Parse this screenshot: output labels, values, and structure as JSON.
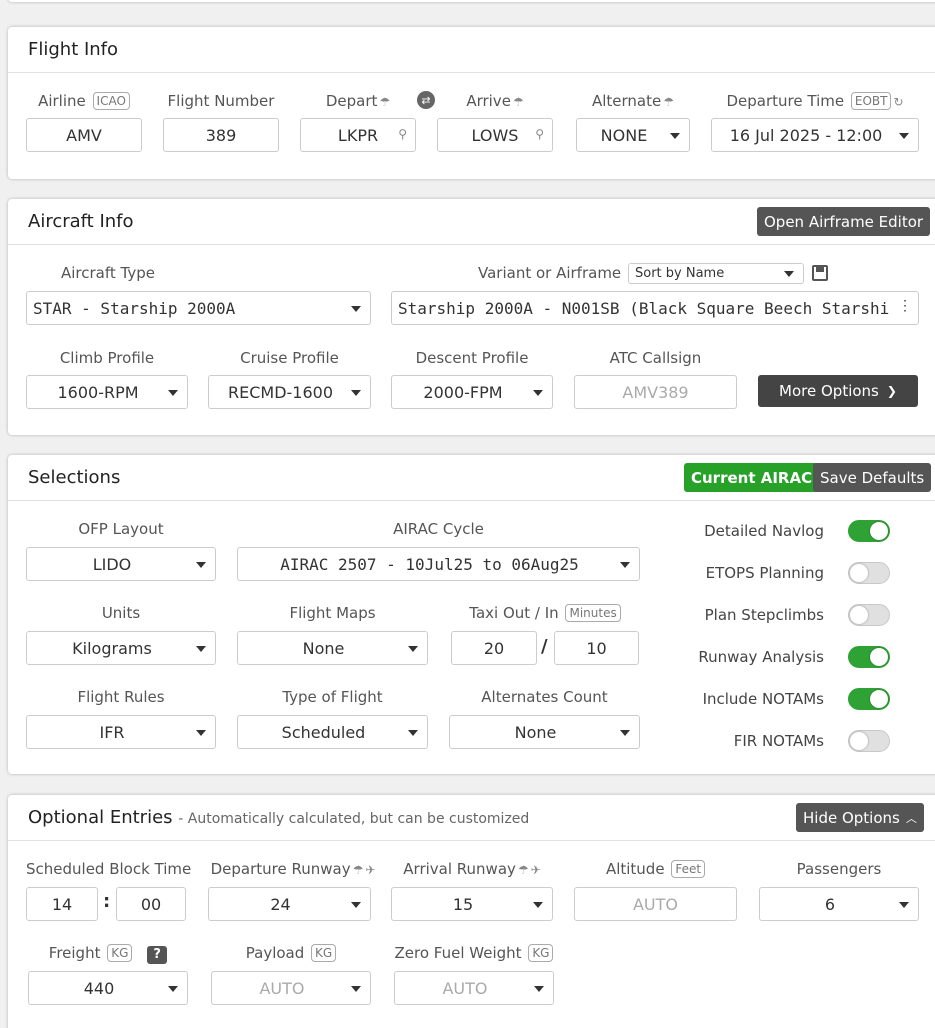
{
  "flight_info": {
    "title": "Flight Info",
    "airline": {
      "label": "Airline",
      "tag": "ICAO",
      "value": "AMV"
    },
    "flight_number": {
      "label": "Flight Number",
      "value": "389"
    },
    "depart": {
      "label": "Depart",
      "value": "LKPR"
    },
    "arrive": {
      "label": "Arrive",
      "value": "LOWS"
    },
    "alternate": {
      "label": "Alternate",
      "value": "NONE"
    },
    "departure_time": {
      "label": "Departure Time",
      "tag": "EOBT",
      "value": "16 Jul 2025 - 12:00"
    }
  },
  "aircraft_info": {
    "title": "Aircraft Info",
    "open_editor_label": "Open Airframe Editor",
    "aircraft_type": {
      "label": "Aircraft Type",
      "value": "STAR - Starship 2000A"
    },
    "variant": {
      "label": "Variant or Airframe",
      "sort_value": "Sort by Name",
      "value": "Starship 2000A - N001SB (Black Square Beech Starshi"
    },
    "climb_profile": {
      "label": "Climb Profile",
      "value": "1600-RPM"
    },
    "cruise_profile": {
      "label": "Cruise Profile",
      "value": "RECMD-1600"
    },
    "descent_profile": {
      "label": "Descent Profile",
      "value": "2000-FPM"
    },
    "atc_callsign": {
      "label": "ATC Callsign",
      "placeholder": "AMV389"
    },
    "more_options_label": "More Options"
  },
  "selections": {
    "title": "Selections",
    "current_airac_label": "Current AIRAC",
    "save_defaults_label": "Save Defaults",
    "ofp_layout": {
      "label": "OFP Layout",
      "value": "LIDO"
    },
    "airac_cycle": {
      "label": "AIRAC Cycle",
      "value": "AIRAC 2507 - 10Jul25 to 06Aug25"
    },
    "units": {
      "label": "Units",
      "value": "Kilograms"
    },
    "flight_maps": {
      "label": "Flight Maps",
      "value": "None"
    },
    "taxi": {
      "label": "Taxi Out / In",
      "tag": "Minutes",
      "out": "20",
      "sep": "/",
      "in": "10"
    },
    "flight_rules": {
      "label": "Flight Rules",
      "value": "IFR"
    },
    "type_of_flight": {
      "label": "Type of Flight",
      "value": "Scheduled"
    },
    "alternates_count": {
      "label": "Alternates Count",
      "value": "None"
    },
    "toggles": [
      {
        "label": "Detailed Navlog",
        "on": true
      },
      {
        "label": "ETOPS Planning",
        "on": false
      },
      {
        "label": "Plan Stepclimbs",
        "on": false
      },
      {
        "label": "Runway Analysis",
        "on": true
      },
      {
        "label": "Include NOTAMs",
        "on": true
      },
      {
        "label": "FIR NOTAMs",
        "on": false
      }
    ]
  },
  "optional_entries": {
    "title": "Optional Entries",
    "subtitle": "- Automatically calculated, but can be customized",
    "hide_options_label": "Hide Options",
    "block_time": {
      "label": "Scheduled Block Time",
      "hours": "14",
      "sep": ":",
      "minutes": "00"
    },
    "departure_runway": {
      "label": "Departure Runway",
      "value": "24"
    },
    "arrival_runway": {
      "label": "Arrival Runway",
      "value": "15"
    },
    "altitude": {
      "label": "Altitude",
      "tag": "Feet",
      "placeholder": "AUTO"
    },
    "passengers": {
      "label": "Passengers",
      "value": "6"
    },
    "freight": {
      "label": "Freight",
      "tag": "KG",
      "help": "?",
      "value": "440"
    },
    "payload": {
      "label": "Payload",
      "tag": "KG",
      "value": "AUTO"
    },
    "zfw": {
      "label": "Zero Fuel Weight",
      "tag": "KG",
      "value": "AUTO"
    }
  }
}
